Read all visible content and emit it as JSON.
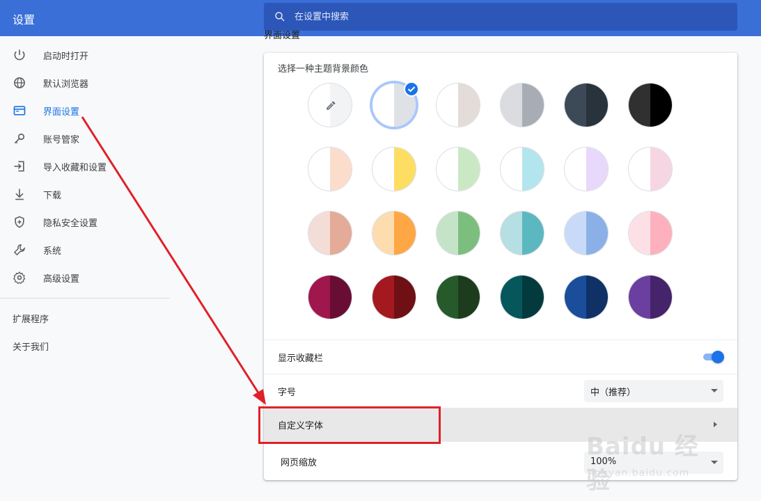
{
  "header": {
    "title": "设置",
    "search_placeholder": "在设置中搜索"
  },
  "sidebar": {
    "items": [
      {
        "label": "启动时打开",
        "icon": "power-icon"
      },
      {
        "label": "默认浏览器",
        "icon": "globe-icon"
      },
      {
        "label": "界面设置",
        "icon": "window-icon"
      },
      {
        "label": "账号管家",
        "icon": "key-icon"
      },
      {
        "label": "导入收藏和设置",
        "icon": "import-icon"
      },
      {
        "label": "下载",
        "icon": "download-icon"
      },
      {
        "label": "隐私安全设置",
        "icon": "shield-icon"
      },
      {
        "label": "系统",
        "icon": "wrench-icon"
      },
      {
        "label": "高级设置",
        "icon": "gear-icon"
      }
    ],
    "links": [
      "扩展程序",
      "关于我们"
    ]
  },
  "section": {
    "title": "界面设置",
    "theme_heading": "选择一种主题背景颜色",
    "theme_colors": [
      [
        [
          "#ffffff",
          "#f1f3f4"
        ],
        [
          "#ffffff",
          "#dee1e6"
        ],
        [
          "#ffffff",
          "#e3dcd9"
        ],
        [
          "#dadce0",
          "#a8acb5"
        ],
        [
          "#3c4a57",
          "#29333b"
        ],
        [
          "#303030",
          "#000000"
        ]
      ],
      [
        [
          "#ffffff",
          "#fcdccb"
        ],
        [
          "#ffffff",
          "#fddd62"
        ],
        [
          "#ffffff",
          "#cbe8c5"
        ],
        [
          "#ffffff",
          "#b3e5ee"
        ],
        [
          "#ffffff",
          "#e8d8fb"
        ],
        [
          "#ffffff",
          "#f6d6e2"
        ]
      ],
      [
        [
          "#f3ddd6",
          "#e3ab98"
        ],
        [
          "#fddcb0",
          "#fea744"
        ],
        [
          "#c5e3c6",
          "#7cbe7e"
        ],
        [
          "#b5dfe2",
          "#5cb8c0"
        ],
        [
          "#c9daf8",
          "#8bb0e8"
        ],
        [
          "#fde0e6",
          "#fdb0bd"
        ]
      ],
      [
        [
          "#a0174d",
          "#6a0d34"
        ],
        [
          "#a3191f",
          "#6e1014"
        ],
        [
          "#275a2a",
          "#1c3c1d"
        ],
        [
          "#05575c",
          "#033a3e"
        ],
        [
          "#1a4e9a",
          "#0f3166"
        ],
        [
          "#6b3fa0",
          "#45246b"
        ]
      ]
    ],
    "selected_theme": "row1-col2",
    "bookmarks_bar_label": "显示收藏栏",
    "bookmarks_bar_on": true,
    "font_size_label": "字号",
    "font_size_value": "中（推荐）",
    "custom_font_label": "自定义字体",
    "zoom_label": "网页缩放",
    "zoom_value": "100%"
  },
  "watermark": {
    "text": "Baidu 经验",
    "sub": "jingyan.baidu.com"
  },
  "colors": {
    "header_bg": "#3a6fd8",
    "search_bg": "#2c57b8",
    "accent": "#1a73e8",
    "annotation": "#e0202a"
  }
}
